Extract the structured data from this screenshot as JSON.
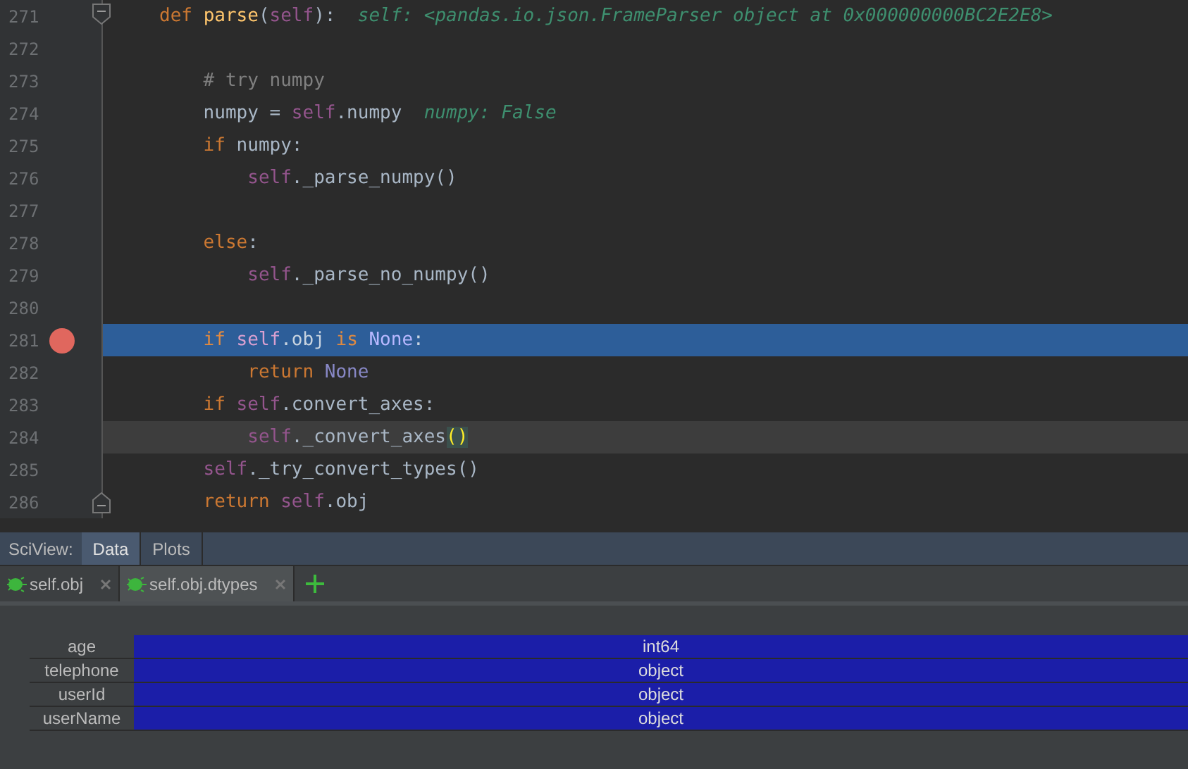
{
  "editor": {
    "lines": [
      {
        "number": "271",
        "fold_start": true,
        "fold_end": false,
        "breakpoint": false,
        "highlighted": false,
        "caret_line": false,
        "tokens": [
          {
            "kind": "keyword",
            "text": "def "
          },
          {
            "kind": "fn",
            "text": "parse"
          },
          {
            "kind": "plain",
            "text": "("
          },
          {
            "kind": "self",
            "text": "self"
          },
          {
            "kind": "plain",
            "text": "):"
          },
          {
            "kind": "hint",
            "text": "  self: <pandas.io.json.FrameParser object at 0x000000000BC2E2E8>"
          }
        ]
      },
      {
        "number": "272",
        "fold_start": false,
        "fold_end": false,
        "breakpoint": false,
        "highlighted": false,
        "caret_line": false
      },
      {
        "number": "273",
        "fold_start": false,
        "fold_end": false,
        "breakpoint": false,
        "highlighted": false,
        "caret_line": false,
        "tokens": [
          {
            "kind": "comment",
            "text": "    # try numpy"
          }
        ]
      },
      {
        "number": "274",
        "fold_start": false,
        "fold_end": false,
        "breakpoint": false,
        "highlighted": false,
        "caret_line": false,
        "tokens": [
          {
            "kind": "plain",
            "text": "    numpy = "
          },
          {
            "kind": "self",
            "text": "self"
          },
          {
            "kind": "plain",
            "text": ".numpy"
          },
          {
            "kind": "hint",
            "text": "  numpy: False"
          }
        ]
      },
      {
        "number": "275",
        "fold_start": false,
        "fold_end": false,
        "breakpoint": false,
        "highlighted": false,
        "caret_line": false,
        "tokens": [
          {
            "kind": "keyword",
            "text": "    if "
          },
          {
            "kind": "plain",
            "text": "numpy:"
          }
        ]
      },
      {
        "number": "276",
        "fold_start": false,
        "fold_end": false,
        "breakpoint": false,
        "highlighted": false,
        "caret_line": false,
        "tokens": [
          {
            "kind": "self",
            "text": "        self"
          },
          {
            "kind": "plain",
            "text": "._parse_numpy()"
          }
        ]
      },
      {
        "number": "277",
        "fold_start": false,
        "fold_end": false,
        "breakpoint": false,
        "highlighted": false,
        "caret_line": false
      },
      {
        "number": "278",
        "fold_start": false,
        "fold_end": false,
        "breakpoint": false,
        "highlighted": false,
        "caret_line": false,
        "tokens": [
          {
            "kind": "keyword",
            "text": "    else"
          },
          {
            "kind": "plain",
            "text": ":"
          }
        ]
      },
      {
        "number": "279",
        "fold_start": false,
        "fold_end": false,
        "breakpoint": false,
        "highlighted": false,
        "caret_line": false,
        "tokens": [
          {
            "kind": "self",
            "text": "        self"
          },
          {
            "kind": "plain",
            "text": "._parse_no_numpy()"
          }
        ]
      },
      {
        "number": "280",
        "fold_start": false,
        "fold_end": false,
        "breakpoint": false,
        "highlighted": false,
        "caret_line": false
      },
      {
        "number": "281",
        "fold_start": false,
        "fold_end": false,
        "breakpoint": true,
        "highlighted": true,
        "caret_line": false,
        "tokens": [
          {
            "kind": "keyword",
            "text": "    if "
          },
          {
            "kind": "self",
            "text": "self"
          },
          {
            "kind": "plain",
            "text": ".obj "
          },
          {
            "kind": "keyword",
            "text": "is "
          },
          {
            "kind": "const",
            "text": "None"
          },
          {
            "kind": "plain",
            "text": ":"
          }
        ]
      },
      {
        "number": "282",
        "fold_start": false,
        "fold_end": false,
        "breakpoint": false,
        "highlighted": false,
        "caret_line": false,
        "tokens": [
          {
            "kind": "keyword",
            "text": "        return "
          },
          {
            "kind": "const",
            "text": "None"
          }
        ]
      },
      {
        "number": "283",
        "fold_start": false,
        "fold_end": false,
        "breakpoint": false,
        "highlighted": false,
        "caret_line": false,
        "tokens": [
          {
            "kind": "keyword",
            "text": "    if "
          },
          {
            "kind": "self",
            "text": "self"
          },
          {
            "kind": "plain",
            "text": ".convert_axes:"
          }
        ]
      },
      {
        "number": "284",
        "fold_start": false,
        "fold_end": false,
        "breakpoint": false,
        "highlighted": false,
        "caret_line": true,
        "tokens": [
          {
            "kind": "self",
            "text": "        self"
          },
          {
            "kind": "plain",
            "text": "._convert_axes"
          },
          {
            "kind": "brace",
            "text": "()"
          }
        ]
      },
      {
        "number": "285",
        "fold_start": false,
        "fold_end": false,
        "breakpoint": false,
        "highlighted": false,
        "caret_line": false,
        "tokens": [
          {
            "kind": "self",
            "text": "    self"
          },
          {
            "kind": "plain",
            "text": "._try_convert_types()"
          }
        ]
      },
      {
        "number": "286",
        "fold_start": false,
        "fold_end": true,
        "breakpoint": false,
        "highlighted": false,
        "caret_line": false,
        "tokens": [
          {
            "kind": "keyword",
            "text": "    return "
          },
          {
            "kind": "self",
            "text": "self"
          },
          {
            "kind": "plain",
            "text": ".obj"
          }
        ]
      }
    ]
  },
  "sciview": {
    "label": "SciView:",
    "tabs": [
      {
        "label": "Data",
        "selected": true
      },
      {
        "label": "Plots",
        "selected": false
      }
    ]
  },
  "data_tabs": [
    {
      "label": "self.obj",
      "selected": false
    },
    {
      "label": "self.obj.dtypes",
      "selected": true
    }
  ],
  "table": {
    "rows": [
      {
        "index": "age",
        "value": "int64"
      },
      {
        "index": "telephone",
        "value": "object"
      },
      {
        "index": "userId",
        "value": "object"
      },
      {
        "index": "userName",
        "value": "object"
      }
    ]
  }
}
